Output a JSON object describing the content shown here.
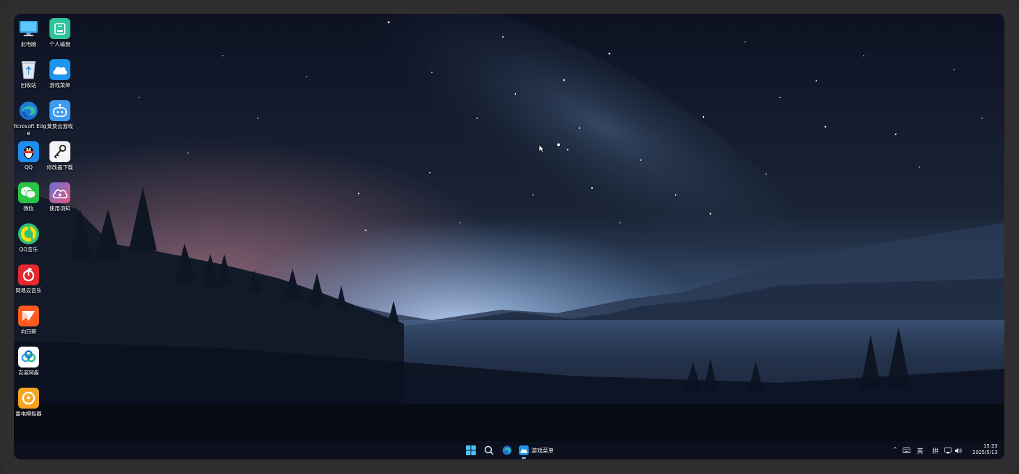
{
  "desktop": {
    "icons": [
      {
        "label": "此电脑",
        "icon": "monitor-icon"
      },
      {
        "label": "个人磁盘",
        "icon": "personal-disk-icon"
      },
      {
        "label": "回收站",
        "icon": "recycle-bin-icon"
      },
      {
        "label": "游戏菜单",
        "icon": "cloud-game-menu-icon"
      },
      {
        "label": "Microsoft Edge",
        "icon": "edge-icon"
      },
      {
        "label": "莱莫云游戏",
        "icon": "gamepad-robot-icon"
      },
      {
        "label": "QQ",
        "icon": "qq-penguin-icon"
      },
      {
        "label": "修改器下载",
        "icon": "wrench-key-icon"
      },
      {
        "label": "微信",
        "icon": "wechat-icon"
      },
      {
        "label": "使用须知",
        "icon": "cloud-notice-icon"
      },
      {
        "label": "QQ音乐",
        "icon": "qq-music-icon"
      },
      {
        "label": "网易云音乐",
        "icon": "netease-music-icon"
      },
      {
        "label": "向日葵",
        "icon": "sunflower-remote-icon"
      },
      {
        "label": "百度网盘",
        "icon": "baidu-netdisk-icon"
      },
      {
        "label": "雷电模拟器",
        "icon": "ldplayer-icon"
      }
    ]
  },
  "taskbar": {
    "active_app_label": "游戏菜单",
    "tray": {
      "ime_lang": "英",
      "ime_mode": "拼"
    },
    "clock": {
      "time": "15:23",
      "date": "2025/5/13"
    }
  },
  "colors": {
    "sky_top": "#0c1120",
    "horizon_glow": "#8fb6e8",
    "pink_glow": "#8a5a6a",
    "forest_dark": "#070b14",
    "accent": "#4aa3ff"
  }
}
